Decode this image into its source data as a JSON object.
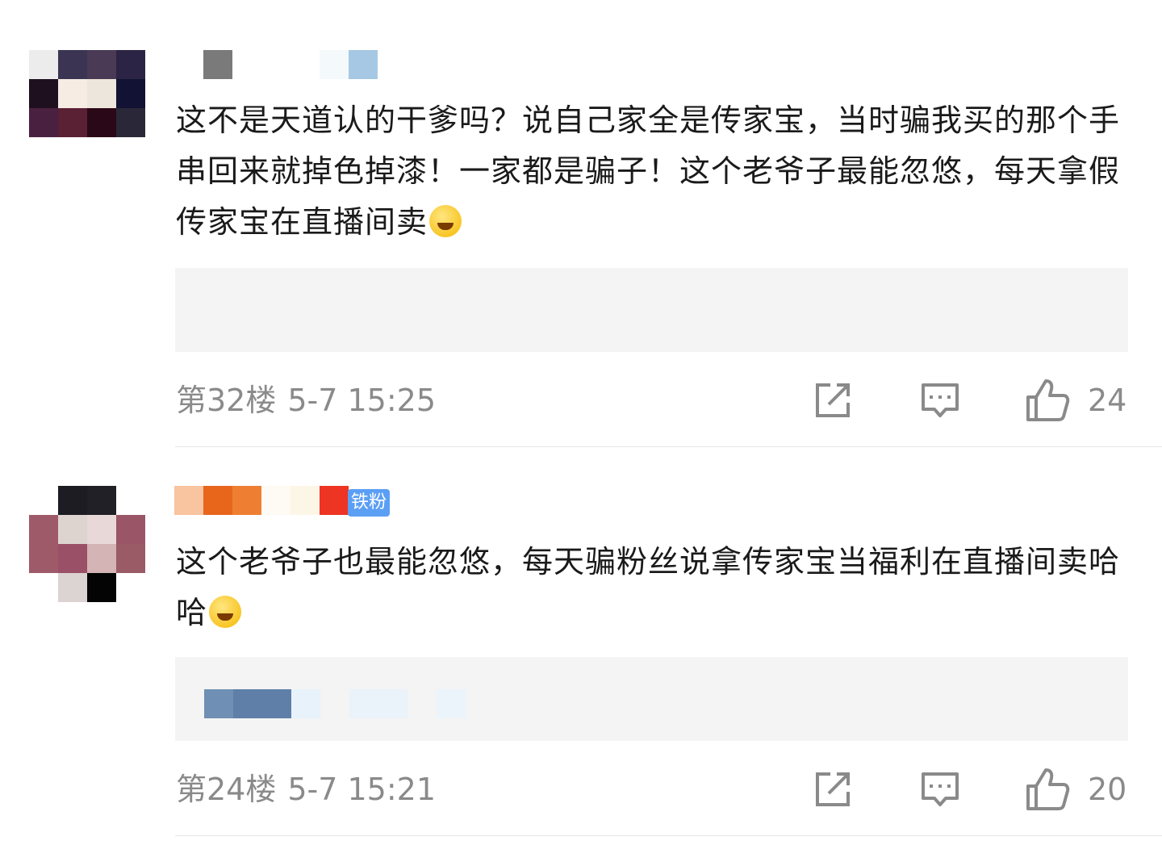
{
  "comments": [
    {
      "text": "这不是天道认的干爹吗？说自己家全是传家宝，当时骗我买的那个手串回来就掉色掉漆！一家都是骗子！这个老爷子最能忽悠，每天拿假传家宝在直播间卖",
      "floor": "第32楼",
      "time": "5-7 15:25",
      "likes": "24",
      "emoji": "smirk-emoji"
    },
    {
      "badge": "铁粉",
      "text": "这个老爷子也最能忽悠，每天骗粉丝说拿传家宝当福利在直播间卖哈哈",
      "floor": "第24楼",
      "time": "5-7 15:21",
      "likes": "20",
      "emoji": "grin-emoji"
    }
  ],
  "icons": {
    "share": "share-icon",
    "reply": "reply-icon",
    "like": "like-icon"
  },
  "colors": {
    "meta": "#8a8a8a",
    "quote_bg": "#f4f4f4",
    "badge": "#5b9ff5"
  }
}
